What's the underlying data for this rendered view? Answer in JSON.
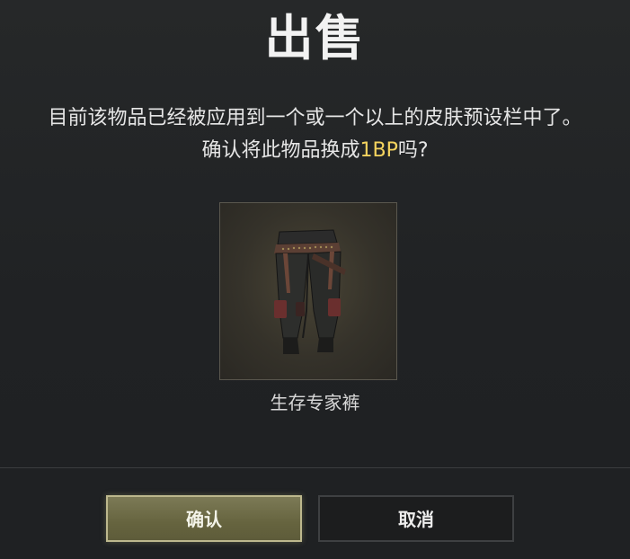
{
  "dialog": {
    "title": "出售",
    "message_line1": "目前该物品已经被应用到一个或一个以上的皮肤预设栏中了。",
    "message_line2_prefix": "确认将此物品换成",
    "message_line2_price": "1BP",
    "message_line2_suffix": "吗?",
    "highlight_color": "#f4d35e"
  },
  "item": {
    "name": "生存专家裤",
    "icon": "pants-icon"
  },
  "buttons": {
    "confirm_label": "确认",
    "cancel_label": "取消"
  }
}
